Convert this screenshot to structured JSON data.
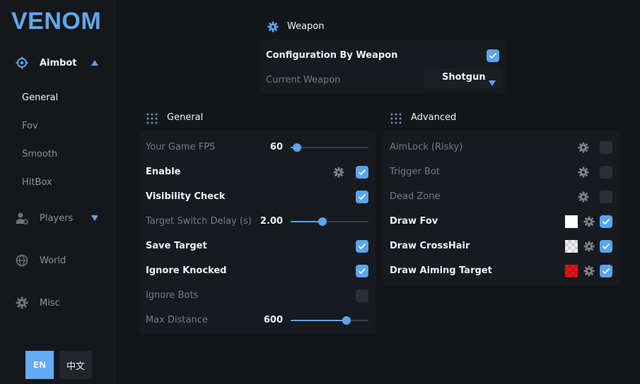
{
  "app": {
    "logo": "VENOM"
  },
  "sidebar": {
    "nav": [
      {
        "label": "Aimbot",
        "icon": "crosshair-icon",
        "expanded": true
      },
      {
        "label": "Players",
        "icon": "users-icon",
        "expanded": false
      },
      {
        "label": "World",
        "icon": "globe-icon"
      },
      {
        "label": "Misc",
        "icon": "gear-icon"
      }
    ],
    "aimbot_sub": [
      "General",
      "Fov",
      "Smooth",
      "HitBox"
    ],
    "active_sub": "General",
    "languages": [
      "EN",
      "中文"
    ],
    "active_language": "EN"
  },
  "weapon_panel": {
    "title": "Weapon",
    "config_by_weapon_label": "Configuration By Weapon",
    "config_by_weapon_checked": true,
    "current_weapon_label": "Current Weapon",
    "current_weapon_value": "Shotgun"
  },
  "general_panel": {
    "title": "General",
    "fps_label": "Your Game FPS",
    "fps_value": "60",
    "fps_fraction": 0.08,
    "enable_label": "Enable",
    "enable_checked": true,
    "visibility_label": "Visibility Check",
    "visibility_checked": true,
    "switch_delay_label": "Target Switch Delay (s)",
    "switch_delay_value": "2.00",
    "switch_delay_fraction": 0.41,
    "save_target_label": "Save Target",
    "save_target_checked": true,
    "ignore_knocked_label": "Ignore Knocked",
    "ignore_knocked_checked": true,
    "ignore_bots_label": "Ignore Bots",
    "ignore_bots_checked": false,
    "max_distance_label": "Max Distance",
    "max_distance_value": "600",
    "max_distance_fraction": 0.72
  },
  "advanced_panel": {
    "title": "Advanced",
    "rows": [
      {
        "label": "AimLock (Risky)",
        "checked": false,
        "swatch": null
      },
      {
        "label": "Trigger Bot",
        "checked": false,
        "swatch": null
      },
      {
        "label": "Dead Zone",
        "checked": false,
        "swatch": null
      },
      {
        "label": "Draw Fov",
        "checked": true,
        "swatch": "#ffffff"
      },
      {
        "label": "Draw CrossHair",
        "checked": true,
        "swatch": "checker"
      },
      {
        "label": "Draw Aiming Target",
        "checked": true,
        "swatch": "#e0161b"
      }
    ]
  },
  "colors": {
    "accent": "#5aa4f0",
    "logo": "#5fa8f0"
  }
}
